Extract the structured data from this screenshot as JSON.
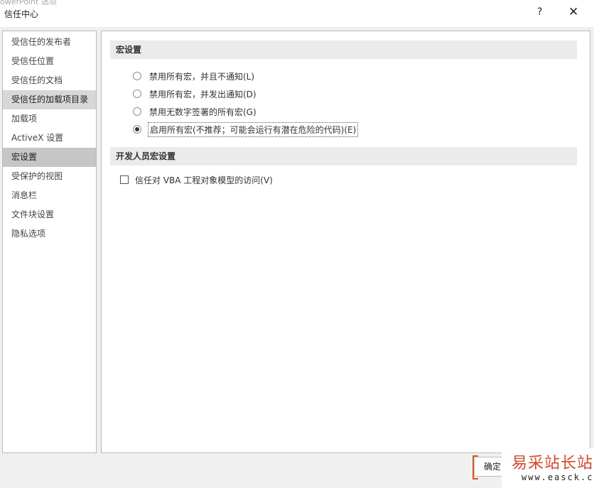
{
  "window": {
    "ghost_title": "owerPoint 选项",
    "title": "信任中心",
    "help_glyph": "?",
    "close_glyph": "✕"
  },
  "sidebar": {
    "items": [
      {
        "label": "受信任的发布者"
      },
      {
        "label": "受信任位置"
      },
      {
        "label": "受信任的文档"
      },
      {
        "label": "受信任的加载项目录",
        "state": "hover"
      },
      {
        "label": "加载项"
      },
      {
        "label": "ActiveX 设置"
      },
      {
        "label": "宏设置",
        "state": "selected"
      },
      {
        "label": "受保护的视图"
      },
      {
        "label": "消息栏"
      },
      {
        "label": "文件块设置"
      },
      {
        "label": "隐私选项"
      }
    ]
  },
  "macro_settings": {
    "header": "宏设置",
    "options": [
      {
        "label": "禁用所有宏，并且不通知(L)",
        "selected": false
      },
      {
        "label": "禁用所有宏，并发出通知(D)",
        "selected": false
      },
      {
        "label": "禁用无数字签署的所有宏(G)",
        "selected": false
      },
      {
        "label": "启用所有宏(不推荐；可能会运行有潜在危险的代码)(E)",
        "selected": true
      }
    ]
  },
  "developer_settings": {
    "header": "开发人员宏设置",
    "trust_vba_label": "信任对 VBA 工程对象模型的访问(V)",
    "trust_vba_checked": false
  },
  "footer": {
    "ok_label": "确定"
  },
  "watermark": {
    "title": "易采站长站",
    "url": "www.easck.com"
  }
}
